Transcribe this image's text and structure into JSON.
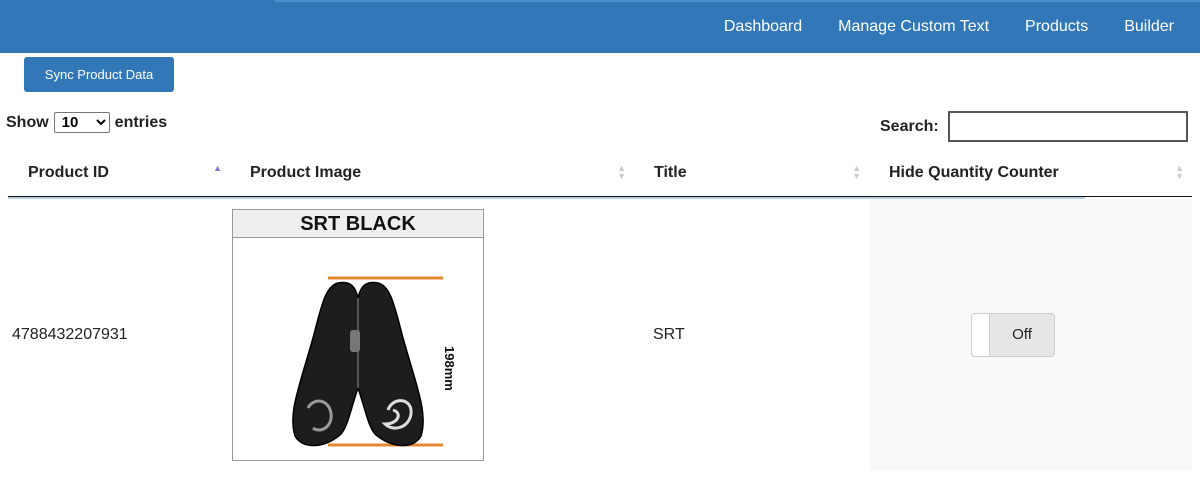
{
  "nav": {
    "items": [
      "Dashboard",
      "Manage Custom Text",
      "Products",
      "Builder"
    ]
  },
  "actions": {
    "sync_label": "Sync Product Data"
  },
  "length": {
    "show": "Show",
    "value": "10",
    "entries": "entries"
  },
  "search": {
    "label": "Search:",
    "value": ""
  },
  "table": {
    "headers": [
      "Product ID",
      "Product Image",
      "Title",
      "Hide Quantity Counter"
    ],
    "sorted_column": "Product ID",
    "rows": [
      {
        "id": "4788432207931",
        "image_title": "SRT BLACK",
        "image_dimension": "198mm",
        "title": "SRT",
        "hide_qty": "Off"
      }
    ]
  },
  "colors": {
    "primary": "#3278b8",
    "sort_active": "#7c7cd6",
    "accent_orange": "#e6892e"
  }
}
